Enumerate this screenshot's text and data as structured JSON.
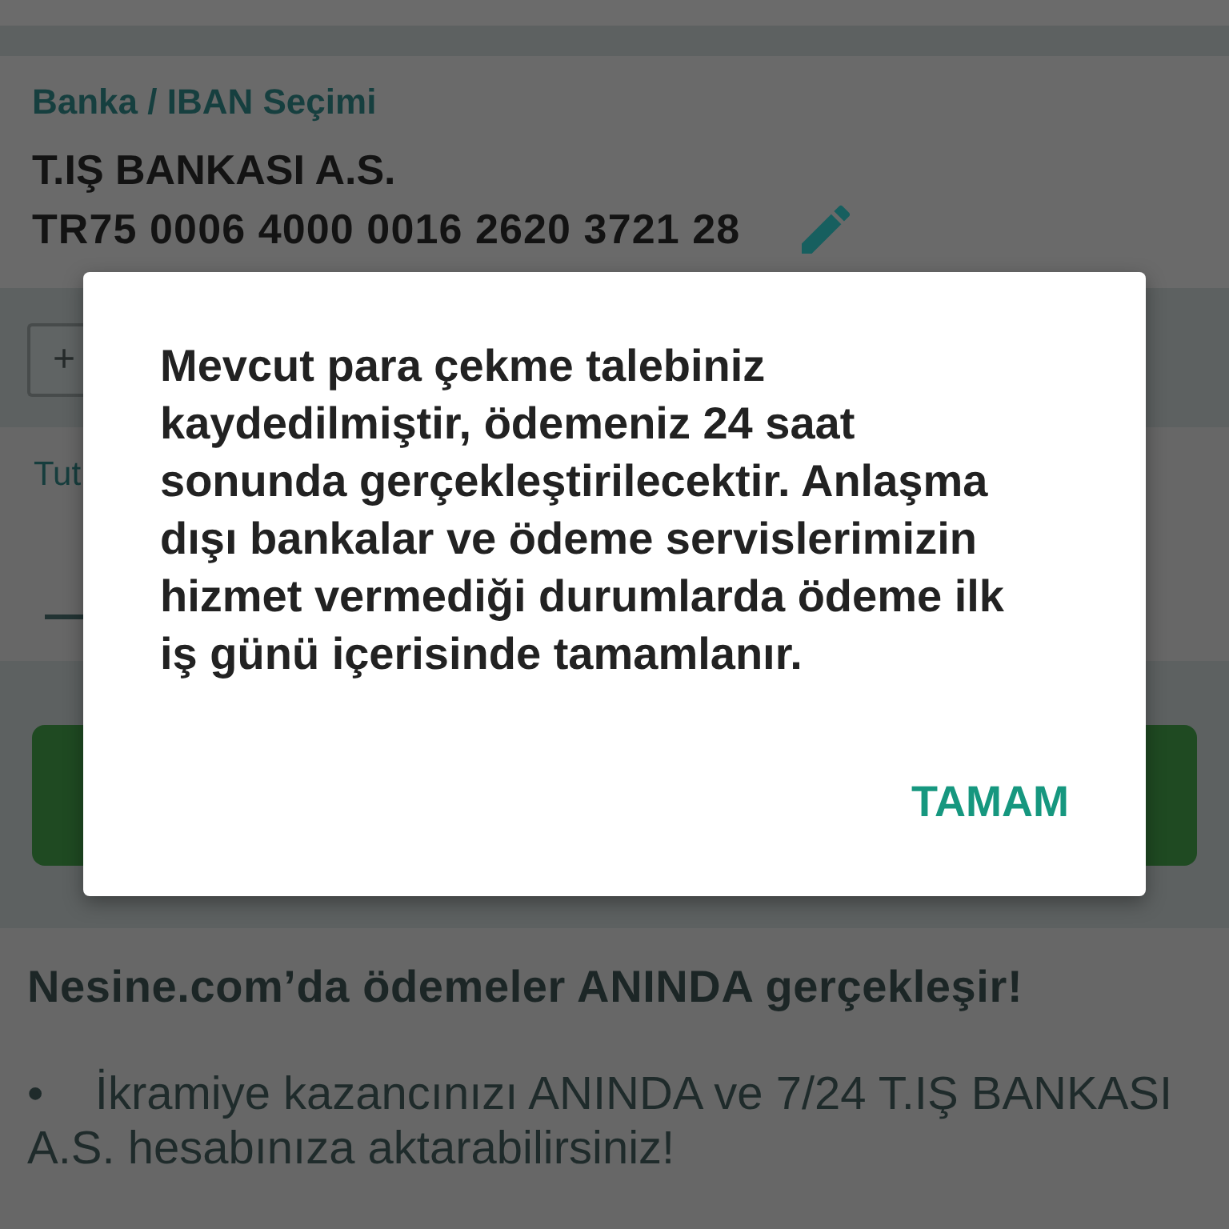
{
  "bank_card": {
    "label": "Banka / IBAN Seçimi",
    "bank_name": "T.IŞ BANKASI A.S.",
    "iban": "TR75 0006 4000 0016 2620 3721 28"
  },
  "add_button": {
    "label": "+"
  },
  "amount_card": {
    "label": "Tut"
  },
  "info_card": {
    "title": "Nesine.com’da ödemeler ANINDA gerçekleşir!",
    "bullets": [
      "•    İkramiye kazancınızı ANINDA ve 7/24 T.IŞ BANKASI A.S. hesabınıza aktarabilirsiniz!"
    ]
  },
  "dialog": {
    "message": "Mevcut para çekme talebiniz kaydedilmiştir, ödemeniz 24 saat sonunda gerçekleştirilecektir. Anlaşma dışı bankalar ve ödeme servislerimizin hizmet vermediği durumlarda ödeme ilk iş günü içerisinde tamamlanır.",
    "buttons": [
      "TAMAM"
    ]
  }
}
